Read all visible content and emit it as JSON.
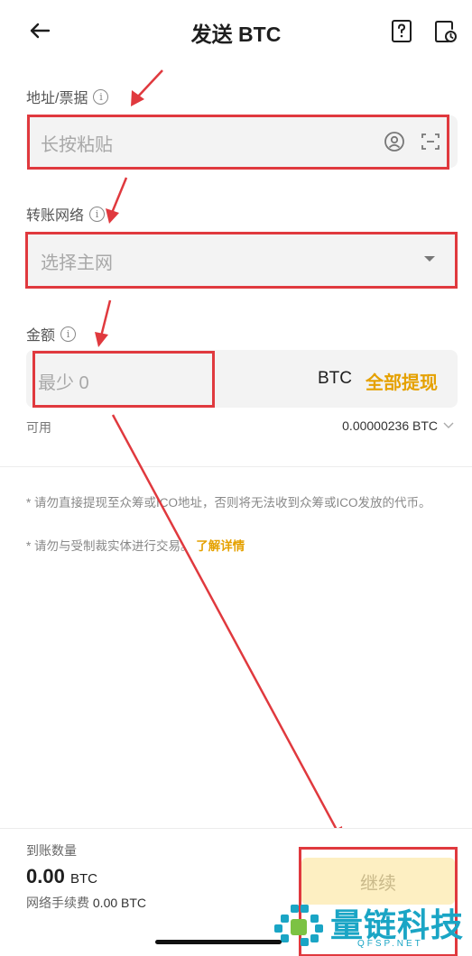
{
  "header": {
    "title": "发送 BTC",
    "back_icon": "arrow-left-icon",
    "help_icon": "help-icon",
    "history_icon": "history-icon"
  },
  "address": {
    "label": "地址/票据",
    "placeholder": "长按粘贴",
    "contact_icon": "contact-icon",
    "scan_icon": "scan-icon"
  },
  "network": {
    "label": "转账网络",
    "placeholder": "选择主网",
    "dropdown_icon": "caret-down-icon"
  },
  "amount": {
    "label": "金额",
    "placeholder": "最少 0",
    "currency": "BTC",
    "withdraw_all": "全部提现",
    "available_label": "可用",
    "available_value": "0.00000236 BTC"
  },
  "notes": {
    "note1": "* 请勿直接提现至众筹或ICO地址，否则将无法收到众筹或ICO发放的代币。",
    "note2": "* 请勿与受制裁实体进行交易。",
    "note2_link": "了解详情"
  },
  "footer": {
    "receive_label": "到账数量",
    "receive_amount": "0.00",
    "receive_unit": "BTC",
    "fee_label": "网络手续费",
    "fee_value": "0.00 BTC",
    "continue": "继续"
  },
  "watermark": {
    "text": "量链科技",
    "sub": "QFSP.NET"
  },
  "colors": {
    "accent": "#e5a100",
    "highlight": "#e0393e",
    "continue_bg": "#fdefc2",
    "field_bg": "#f3f3f3"
  }
}
